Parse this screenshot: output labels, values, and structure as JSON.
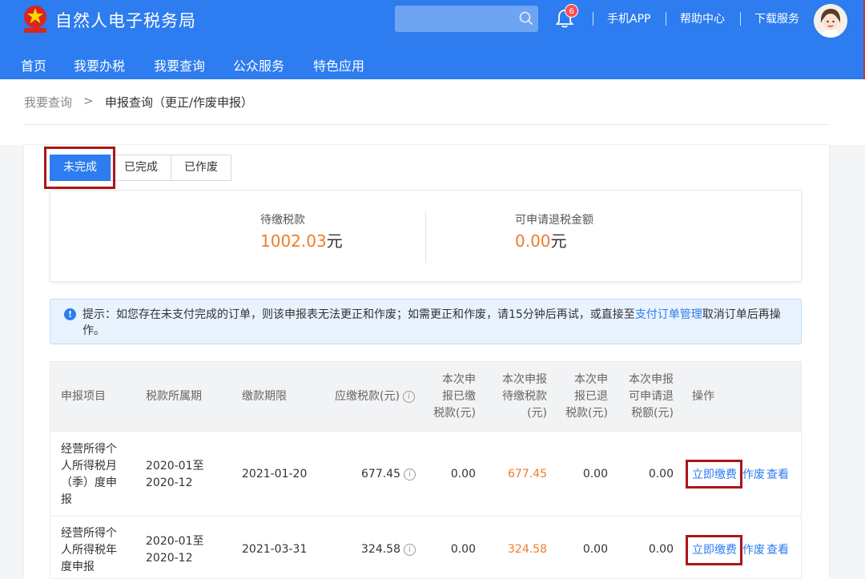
{
  "header": {
    "app_title": "自然人电子税务局",
    "notification_count": "6",
    "links": [
      "手机APP",
      "帮助中心",
      "下载服务"
    ]
  },
  "nav": [
    "首页",
    "我要办税",
    "我要查询",
    "公众服务",
    "特色应用"
  ],
  "breadcrumb": {
    "parent": "我要查询",
    "separator": ">",
    "current": "申报查询（更正/作废申报）"
  },
  "tabs": [
    {
      "label": "未完成",
      "active": true
    },
    {
      "label": "已完成",
      "active": false
    },
    {
      "label": "已作废",
      "active": false
    }
  ],
  "summary": {
    "pending_label": "待缴税款",
    "pending_value": "1002.03",
    "pending_unit": "元",
    "refund_label": "可申请退税金额",
    "refund_value": "0.00",
    "refund_unit": "元"
  },
  "notice": {
    "prefix": "提示：如您存在未支付完成的订单，则该申报表无法更正和作废；如需更正和作废，请15分钟后再试，或直接至",
    "link": "支付订单管理",
    "suffix": "取消订单后再操作。"
  },
  "table": {
    "headers": {
      "item": "申报项目",
      "period": "税款所属期",
      "deadline": "缴款期限",
      "payable": "应缴税款(元)",
      "paid_1": "本次申",
      "paid_2": "报已缴",
      "paid_3": "税款(元)",
      "topay_1": "本次申报",
      "topay_2": "待缴税款",
      "topay_3": "(元)",
      "refunded_1": "本次申",
      "refunded_2": "报已退",
      "refunded_3": "税款(元)",
      "refundable_1": "本次申报",
      "refundable_2": "可申请退",
      "refundable_3": "税额(元)",
      "ops": "操作"
    },
    "rows": [
      {
        "item_lines": [
          "经营所得个",
          "人所得税月",
          "（季）度申",
          "报"
        ],
        "period_lines": [
          "2020-01至",
          "2020-12"
        ],
        "deadline": "2021-01-20",
        "payable": "677.45",
        "paid": "0.00",
        "topay": "677.45",
        "refunded": "0.00",
        "refundable": "0.00",
        "ops": [
          "立即缴费",
          "作废",
          "查看"
        ]
      },
      {
        "item_lines": [
          "经营所得个",
          "人所得税年",
          "度申报"
        ],
        "period_lines": [
          "2020-01至",
          "2020-12"
        ],
        "deadline": "2021-03-31",
        "payable": "324.58",
        "paid": "0.00",
        "topay": "324.58",
        "refunded": "0.00",
        "refundable": "0.00",
        "ops": [
          "立即缴费",
          "作废",
          "查看"
        ]
      }
    ]
  },
  "colors": {
    "primary": "#2d7cf0",
    "accent_orange": "#f07c2a",
    "highlight_red": "#a8161b"
  }
}
